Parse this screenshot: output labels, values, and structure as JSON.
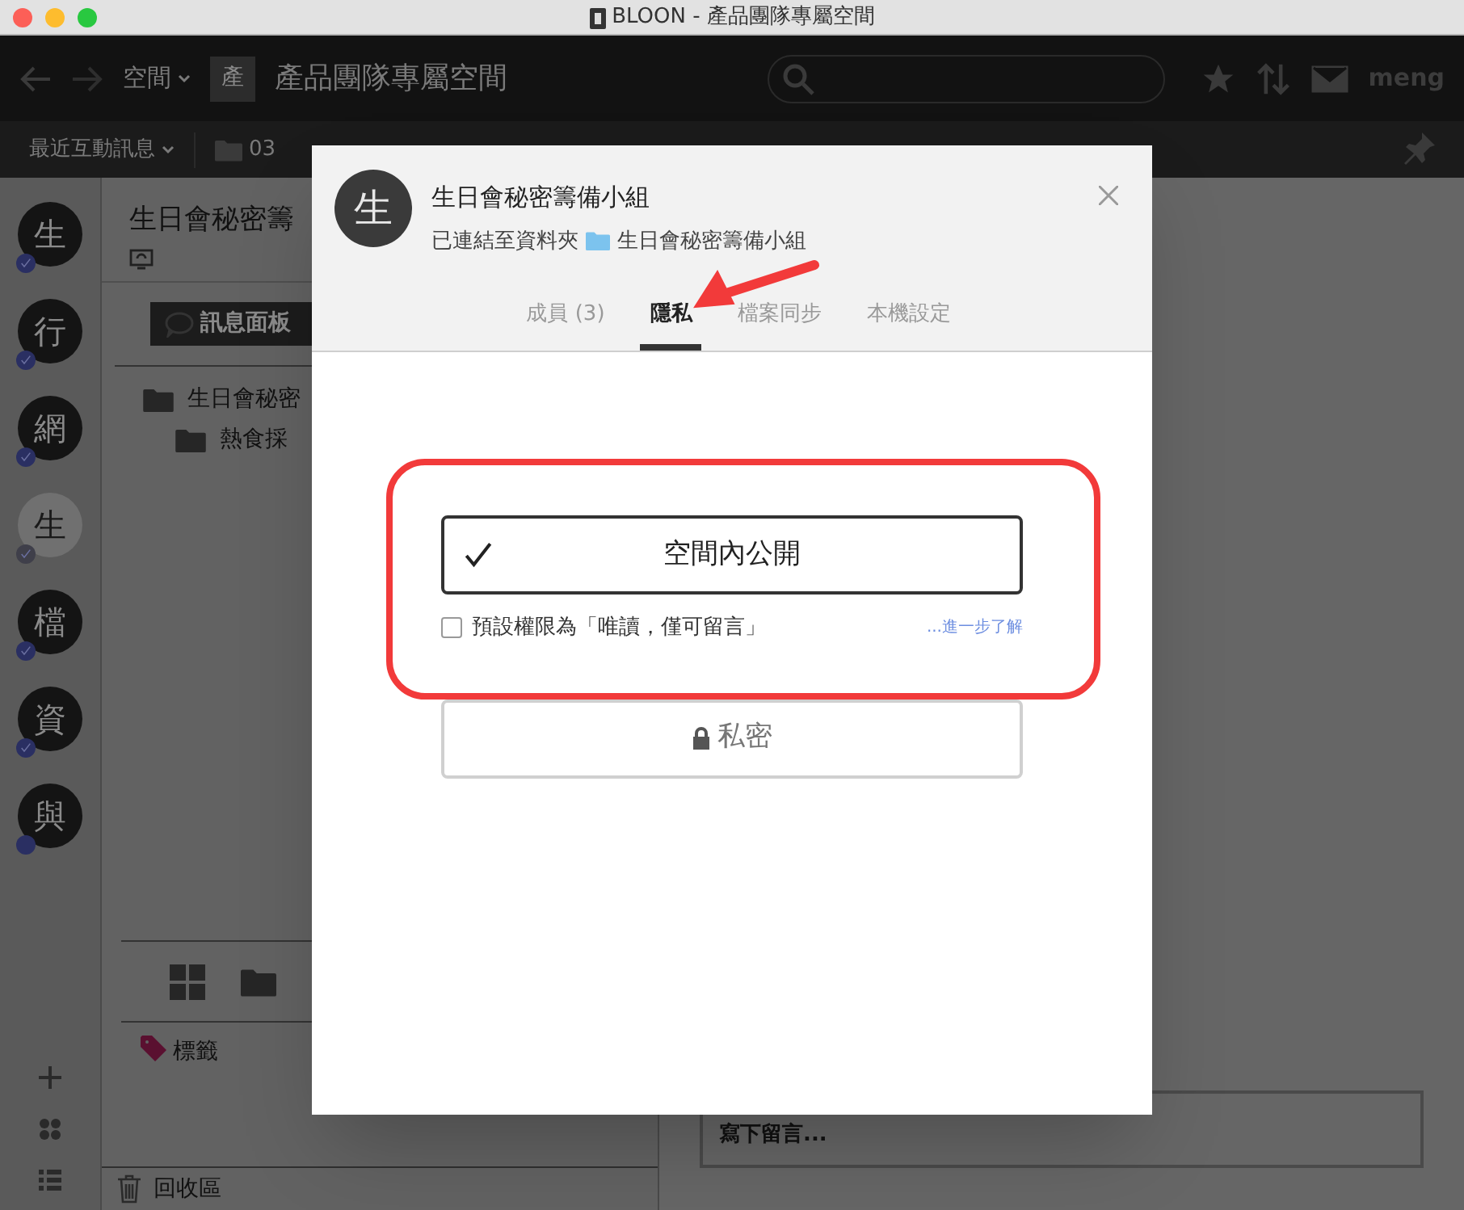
{
  "window": {
    "title": "BLOON - 產品團隊專屬空間"
  },
  "toolbar": {
    "space_menu": "空間",
    "space_badge": "產",
    "space_name": "產品團隊專屬空間",
    "user": "meng"
  },
  "subbar": {
    "recent": "最近互動訊息",
    "folder": "03"
  },
  "rail": {
    "spaces": [
      {
        "initial": "生",
        "checked": true,
        "faded": false
      },
      {
        "initial": "行",
        "checked": true,
        "faded": false
      },
      {
        "initial": "網",
        "checked": true,
        "faded": false
      },
      {
        "initial": "生",
        "checked": true,
        "faded": true
      },
      {
        "initial": "檔",
        "checked": true,
        "faded": false
      },
      {
        "initial": "資",
        "checked": true,
        "faded": false
      },
      {
        "initial": "與",
        "checked": false,
        "faded": false
      }
    ]
  },
  "panel": {
    "title": "生日會秘密籌",
    "message_board": "訊息面板",
    "tree": [
      {
        "label": "生日會秘密",
        "children": [
          {
            "label": "熱食採"
          }
        ]
      }
    ],
    "tags": "標籤",
    "trash": "回收區"
  },
  "comment": {
    "placeholder": "寫下留言..."
  },
  "dialog": {
    "avatar": "生",
    "title": "生日會秘密籌備小組",
    "linked_label": "已連結至資料夾",
    "linked_folder": "生日會秘密籌備小組",
    "tabs": [
      {
        "label": "成員 (3)",
        "selected": false
      },
      {
        "label": "隱私",
        "selected": true
      },
      {
        "label": "檔案同步",
        "selected": false
      },
      {
        "label": "本機設定",
        "selected": false
      }
    ],
    "options": [
      {
        "kind": "public",
        "label": "空間內公開",
        "selected": true
      },
      {
        "kind": "private",
        "label": "私密",
        "selected": false
      }
    ],
    "readonly": {
      "label": "預設權限為「唯讀，僅可留言」",
      "checked": false
    },
    "learn_more": "...進一步了解"
  }
}
